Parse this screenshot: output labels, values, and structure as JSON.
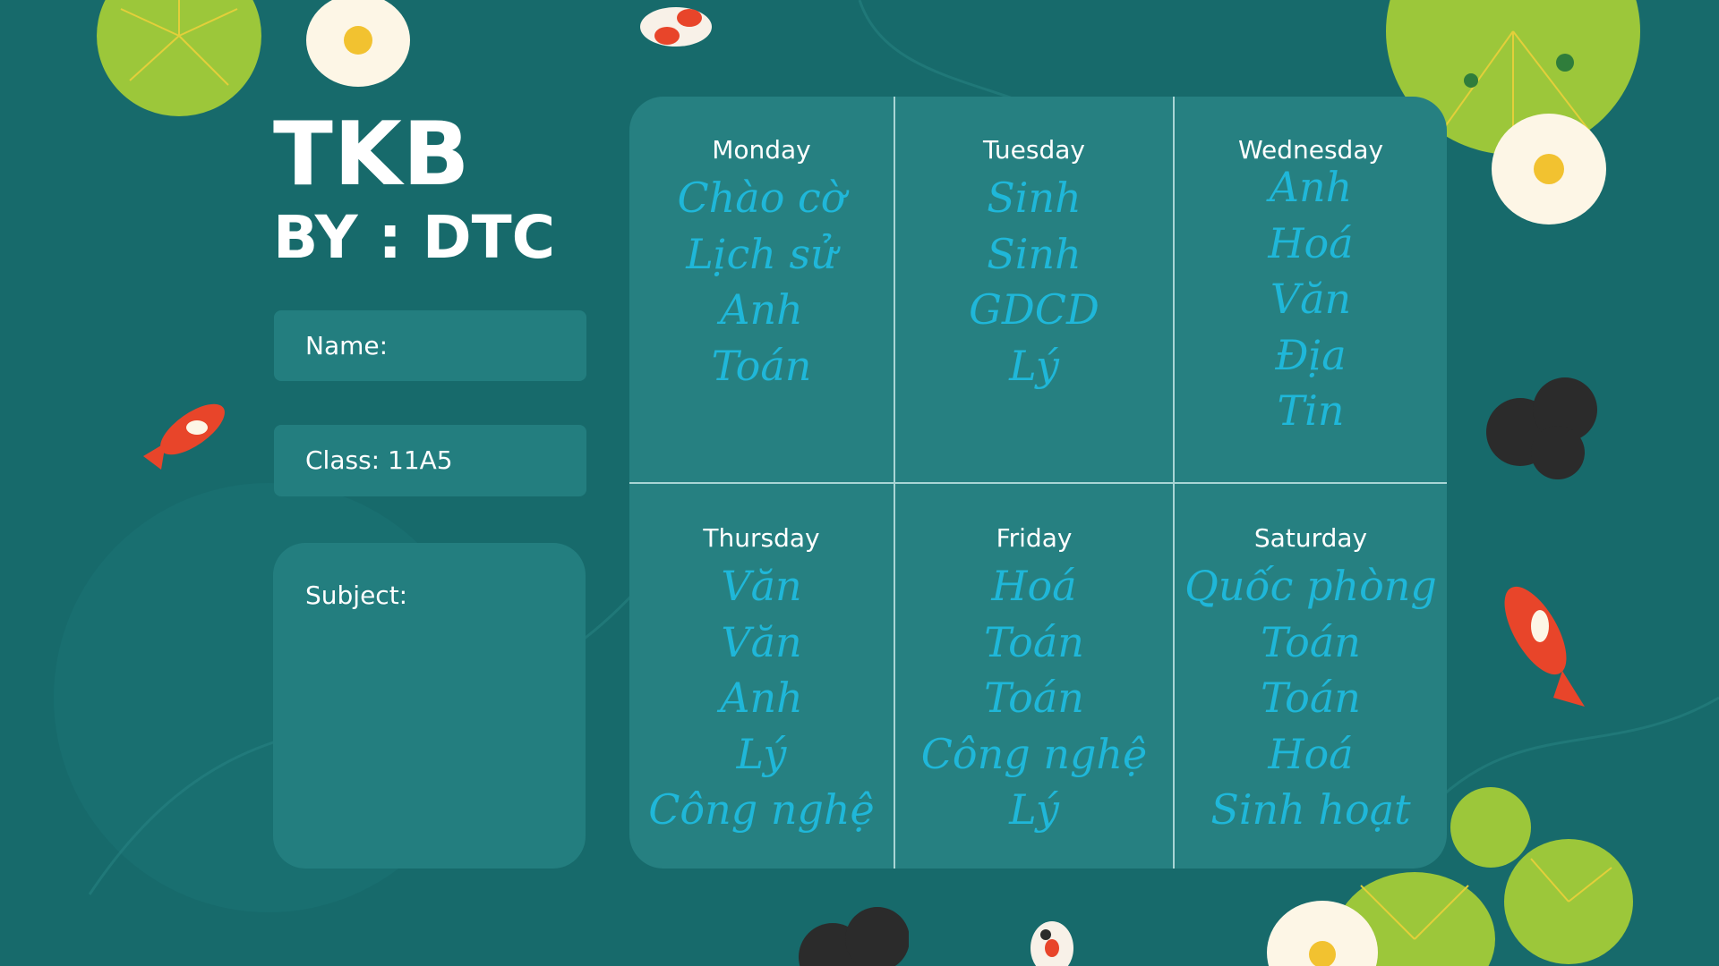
{
  "header": {
    "title": "TKB",
    "byline": "BY : DTC"
  },
  "form": {
    "name_label": "Name:",
    "class_label": "Class: 11A5",
    "subject_label": "Subject:"
  },
  "schedule": {
    "days": [
      {
        "name": "Monday",
        "subjects": [
          "Chào cờ",
          "Lịch sử",
          "Anh",
          "Toán"
        ]
      },
      {
        "name": "Tuesday",
        "subjects": [
          "Sinh",
          "Sinh",
          "GDCD",
          "Lý"
        ]
      },
      {
        "name": "Wednesday",
        "subjects": [
          "Anh",
          "Hoá",
          "Văn",
          "Địa",
          "Tin"
        ]
      },
      {
        "name": "Thursday",
        "subjects": [
          "Văn",
          "Văn",
          "Anh",
          "Lý",
          "Công nghệ"
        ]
      },
      {
        "name": "Friday",
        "subjects": [
          "Hoá",
          "Toán",
          "Toán",
          "Công nghệ",
          "Lý"
        ]
      },
      {
        "name": "Saturday",
        "subjects": [
          "Quốc phòng",
          "Toán",
          "Toán",
          "Hoá",
          "Sinh hoạt"
        ]
      }
    ]
  },
  "colors": {
    "background": "#176a6b",
    "panel": "#268081",
    "subject_text": "#1fb7d9",
    "lily_pad": "#9cc73a"
  }
}
